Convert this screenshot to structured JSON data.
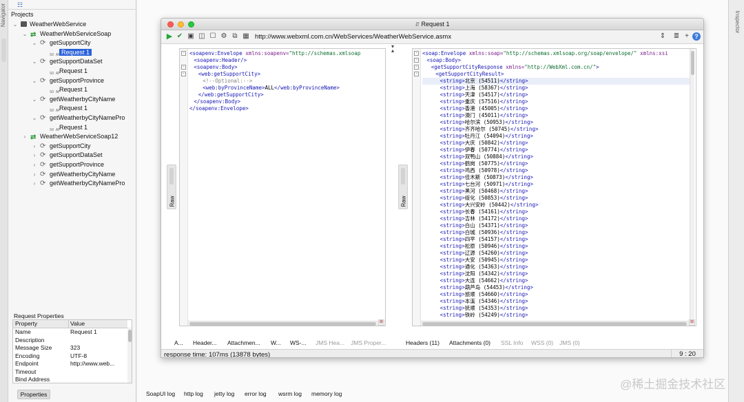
{
  "navigator": {
    "label": "Navigator"
  },
  "inspector": {
    "label": "Inspector"
  },
  "tree": {
    "root_label": "Projects",
    "project": "WeatherWebService",
    "interfaces": [
      {
        "name": "WeatherWebServiceSoap",
        "operations": [
          {
            "name": "getSupportCity",
            "request": "Request 1"
          },
          {
            "name": "getSupportDataSet",
            "request": "Request 1"
          },
          {
            "name": "getSupportProvince",
            "request": "Request 1"
          },
          {
            "name": "getWeatherbyCityName",
            "request": "Request 1"
          },
          {
            "name": "getWeatherbyCityNamePro",
            "request": "Request 1"
          }
        ]
      },
      {
        "name": "WeatherWebServiceSoap12",
        "operations": [
          {
            "name": "getSupportCity"
          },
          {
            "name": "getSupportDataSet"
          },
          {
            "name": "getSupportProvince"
          },
          {
            "name": "getWeatherbyCityName"
          },
          {
            "name": "getWeatherbyCityNamePro"
          }
        ]
      }
    ],
    "request_icon_text": "SO\nAP"
  },
  "request_properties": {
    "title": "Request Properties",
    "col_property": "Property",
    "col_value": "Value",
    "rows": [
      {
        "k": "Name",
        "v": "Request 1"
      },
      {
        "k": "Description",
        "v": ""
      },
      {
        "k": "Message Size",
        "v": "323"
      },
      {
        "k": "Encoding",
        "v": "UTF-8"
      },
      {
        "k": "Endpoint",
        "v": "http://www.web..."
      },
      {
        "k": "Timeout",
        "v": ""
      },
      {
        "k": "Bind Address",
        "v": ""
      }
    ],
    "tab": "Properties"
  },
  "window": {
    "title": "Request 1",
    "endpoint": "http://www.webxml.com.cn/WebServices/WeatherWebService.asmx"
  },
  "request_tab": "Raw",
  "response_tab": "Raw",
  "request_xml": [
    {
      "indent": 0,
      "fold": "-",
      "p": [
        [
          "tag",
          "<soapenv:Envelope "
        ],
        [
          "att",
          "xmlns:soapenv="
        ],
        [
          "val",
          "\"http://schemas.xmlsoap"
        ]
      ]
    },
    {
      "indent": 2,
      "fold": "",
      "p": [
        [
          "tag",
          "<soapenv:Header/>"
        ]
      ]
    },
    {
      "indent": 2,
      "fold": "-",
      "p": [
        [
          "tag",
          "<soapenv:Body>"
        ]
      ]
    },
    {
      "indent": 4,
      "fold": "-",
      "p": [
        [
          "tag",
          "<web:getSupportCity>"
        ]
      ]
    },
    {
      "indent": 6,
      "fold": "",
      "p": [
        [
          "cmt",
          "<!--Optional:-->"
        ]
      ]
    },
    {
      "indent": 6,
      "fold": "",
      "p": [
        [
          "tag",
          "<web:byProvinceName>"
        ],
        [
          "txt",
          "ALL"
        ],
        [
          "tag",
          "</web:byProvinceName>"
        ]
      ]
    },
    {
      "indent": 4,
      "fold": "",
      "p": [
        [
          "tag",
          "</web:getSupportCity>"
        ]
      ]
    },
    {
      "indent": 2,
      "fold": "",
      "p": [
        [
          "tag",
          "</soapenv:Body>"
        ]
      ]
    },
    {
      "indent": 0,
      "fold": "",
      "p": [
        [
          "tag",
          "</soapenv:Envelope>"
        ]
      ]
    }
  ],
  "response_header_xml": [
    {
      "indent": 0,
      "fold": "-",
      "p": [
        [
          "tag",
          "<soap:Envelope "
        ],
        [
          "att",
          "xmlns:soap="
        ],
        [
          "val",
          "\"http://schemas.xmlsoap.org/soap/envelope/\""
        ],
        [
          "att",
          " xmlns:xsi"
        ]
      ]
    },
    {
      "indent": 2,
      "fold": "-",
      "p": [
        [
          "tag",
          "<soap:Body>"
        ]
      ]
    },
    {
      "indent": 4,
      "fold": "-",
      "p": [
        [
          "tag",
          "<getSupportCityResponse "
        ],
        [
          "att",
          "xmlns="
        ],
        [
          "val",
          "\"http://WebXml.com.cn/\""
        ],
        [
          "tag",
          ">"
        ]
      ]
    },
    {
      "indent": 6,
      "fold": "-",
      "p": [
        [
          "tag",
          "<getSupportCityResult>"
        ]
      ]
    }
  ],
  "cities": [
    "北京 (54511)",
    "上海 (58367)",
    "天津 (54517)",
    "重庆 (57516)",
    "香港 (45005)",
    "澳门 (45011)",
    "哈尔滨 (50953)",
    "齐齐哈尔 (50745)",
    "牡丹江 (54094)",
    "大庆 (50842)",
    "伊春 (50774)",
    "双鸭山 (50884)",
    "鹤岗 (50775)",
    "鸡西 (50978)",
    "佳木斯 (50873)",
    "七台河 (50971)",
    "黑河 (50468)",
    "绥化 (50853)",
    "大兴安岭 (50442)",
    "长春 (54161)",
    "吉林 (54172)",
    "白山 (54371)",
    "白城 (50936)",
    "四平 (54157)",
    "松原 (50946)",
    "辽源 (54260)",
    "大安 (50945)",
    "通化 (54363)",
    "沈阳 (54342)",
    "大连 (54662)",
    "葫芦岛 (54453)",
    "旅顺 (54660)",
    "本溪 (54346)",
    "抚顺 (54353)",
    "铁岭 (54249)"
  ],
  "req_bottom_tabs": [
    "A...",
    "Header...",
    "Attachmen...",
    "W...",
    "WS-...",
    "JMS Hea...",
    "JMS Proper..."
  ],
  "resp_bottom_tabs": [
    "Headers (11)",
    "Attachments (0)",
    "SSL Info",
    "WSS (0)",
    "JMS (0)"
  ],
  "status": {
    "text": "response time: 107ms (13878 bytes)",
    "position": "9 : 20"
  },
  "log_tabs": [
    "SoapUI log",
    "http log",
    "jetty log",
    "error log",
    "wsrm log",
    "memory log"
  ],
  "watermark": "@稀土掘金技术社区"
}
